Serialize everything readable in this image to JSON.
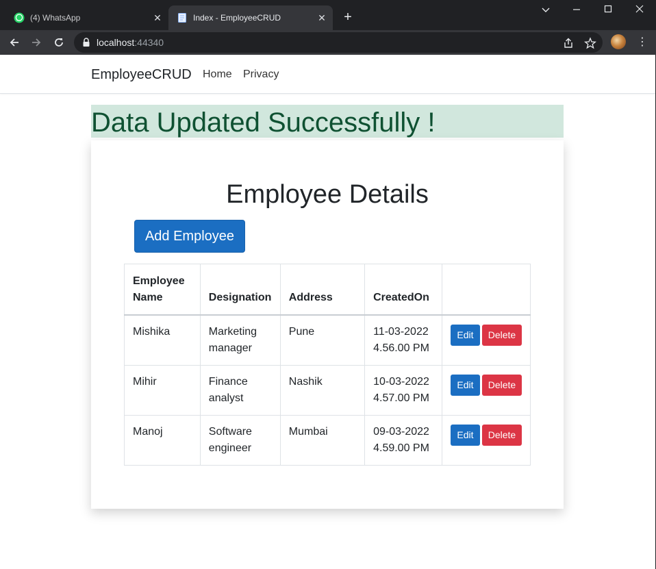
{
  "browser": {
    "tabs": [
      {
        "title": "(4) WhatsApp",
        "active": false,
        "icon": "whatsapp-icon"
      },
      {
        "title": "Index - EmployeeCRUD",
        "active": true,
        "icon": "page-icon"
      }
    ],
    "url_host": "localhost",
    "url_port": ":44340"
  },
  "navbar": {
    "brand": "EmployeeCRUD",
    "links": [
      "Home",
      "Privacy"
    ]
  },
  "alert": {
    "message": "Data Updated Successfully !",
    "bg_color": "#d1e7dd",
    "text_color": "#0f5132"
  },
  "main": {
    "title": "Employee Details",
    "add_button": "Add Employee",
    "table": {
      "headers": [
        "Employee Name",
        "Designation",
        "Address",
        "CreatedOn",
        ""
      ],
      "rows": [
        {
          "name": "Mishika",
          "designation": "Marketing manager",
          "address": "Pune",
          "created_on": "11-03-2022 4.56.00 PM"
        },
        {
          "name": "Mihir",
          "designation": "Finance analyst",
          "address": "Nashik",
          "created_on": "10-03-2022 4.57.00 PM"
        },
        {
          "name": "Manoj",
          "designation": "Software engineer",
          "address": "Mumbai",
          "created_on": "09-03-2022 4.59.00 PM"
        }
      ],
      "edit_label": "Edit",
      "delete_label": "Delete"
    }
  },
  "colors": {
    "primary": "#1b6ec2",
    "danger": "#dc3545"
  }
}
